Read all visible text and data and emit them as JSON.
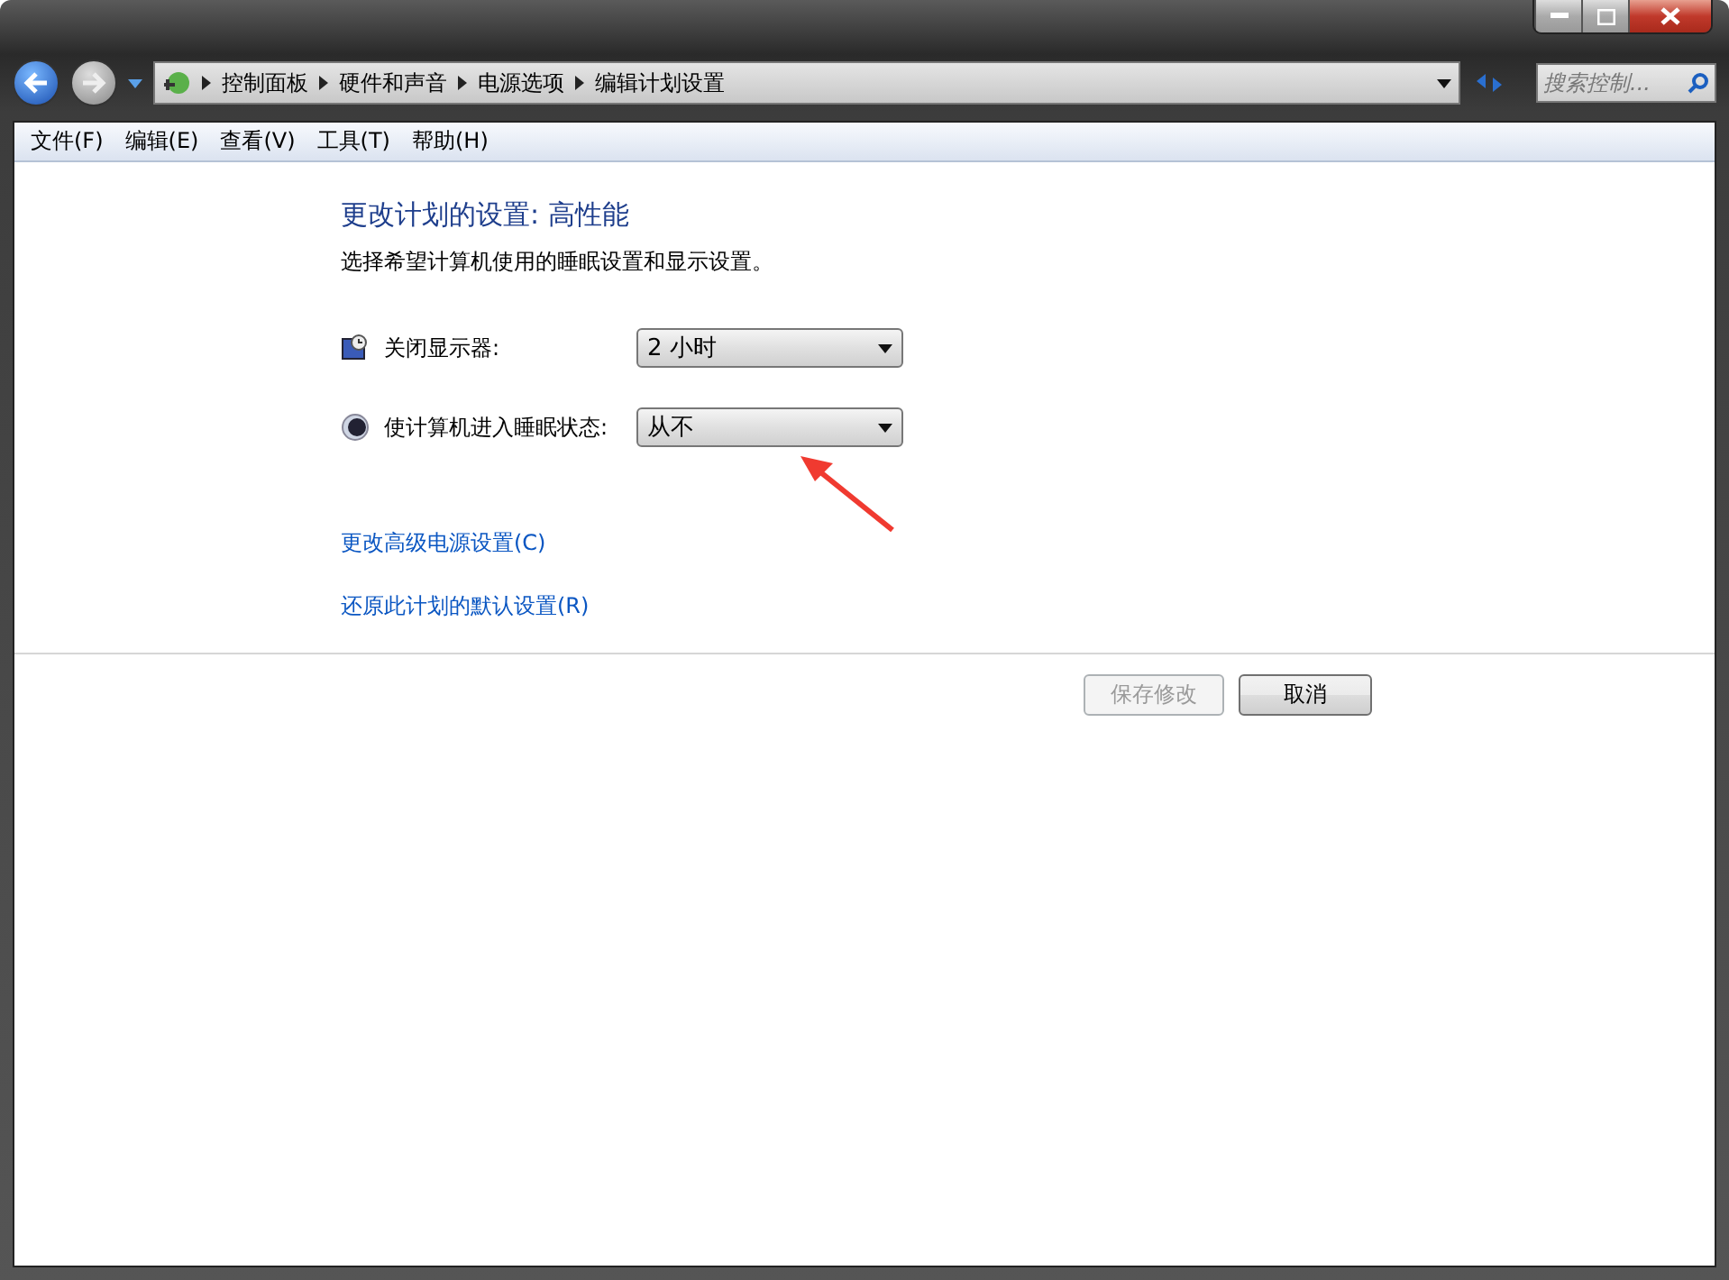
{
  "breadcrumb": [
    "控制面板",
    "硬件和声音",
    "电源选项",
    "编辑计划设置"
  ],
  "search": {
    "placeholder": "搜索控制..."
  },
  "menu": [
    "文件(F)",
    "编辑(E)",
    "查看(V)",
    "工具(T)",
    "帮助(H)"
  ],
  "heading": "更改计划的设置: 高性能",
  "description": "选择希望计算机使用的睡眠设置和显示设置。",
  "settings": [
    {
      "kind": "display",
      "label": "关闭显示器:",
      "value": "2 小时"
    },
    {
      "kind": "sleep",
      "label": "使计算机进入睡眠状态:",
      "value": "从不"
    }
  ],
  "links": [
    "更改高级电源设置(C)",
    "还原此计划的默认设置(R)"
  ],
  "buttons": [
    {
      "label": "保存修改",
      "disabled": true
    },
    {
      "label": "取消",
      "disabled": false
    }
  ]
}
